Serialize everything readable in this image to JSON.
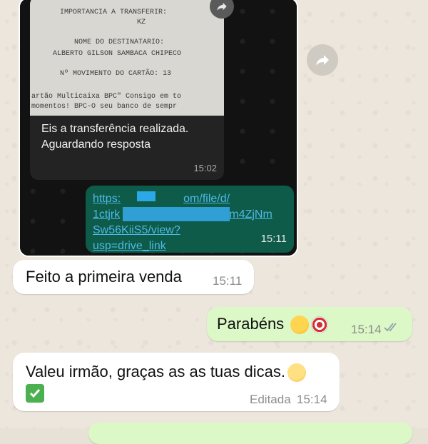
{
  "forwarded_screenshot": {
    "receipt_lines": [
      "IMPORTANCIA A TRANSFERIR:",
      "KZ",
      "NOME DO DESTINATARIO:",
      "ALBERTO GILSON SAMBACA CHIPECO",
      "Nº MOVIMENTO DO CARTÃO: 13",
      "artão Multicaixa BPC\" Consigo em to",
      "momentos! BPC-O seu banco de sempr"
    ],
    "caption": "Eis a transferência realizada. Aguardando resposta",
    "caption_time": "15:02",
    "link_lines": [
      "https:",
      "om/file/d/",
      "1ctjrk",
      "Plbm4ZjNm",
      "Sw56KiiS5/view?",
      "usp=drive_link"
    ],
    "link_time": "15:11"
  },
  "messages": [
    {
      "text": "Feito  a primeira venda",
      "time": "15:11",
      "direction": "incoming"
    },
    {
      "text": "Parabéns",
      "time": "15:14",
      "direction": "outgoing",
      "emojis": [
        "partying-face-emoji",
        "target-emoji"
      ],
      "status": "read"
    },
    {
      "text": "Valeu irmão, graças as as tuas dicas.",
      "time": "15:14",
      "edited_label": "Editada",
      "direction": "incoming",
      "emojis": [
        "relieved-face-emoji",
        "check-mark-emoji"
      ]
    }
  ],
  "colors": {
    "incoming_bubble": "#ffffff",
    "outgoing_bubble": "#dcf8c6",
    "wallpaper": "#ece6dc",
    "link": "#4fb8e8"
  }
}
